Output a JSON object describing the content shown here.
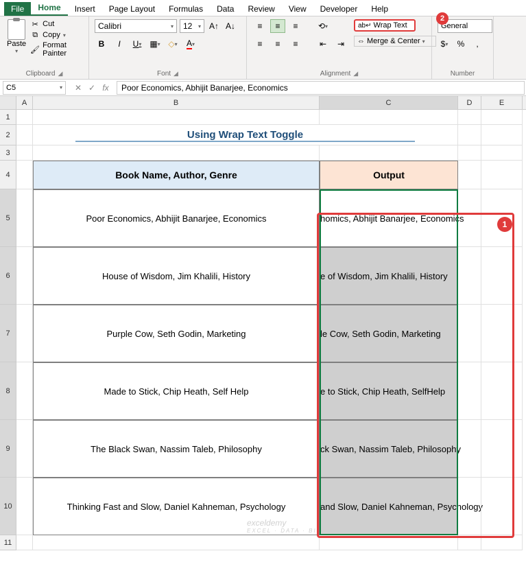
{
  "tabs": {
    "file": "File",
    "home": "Home",
    "insert": "Insert",
    "pagelayout": "Page Layout",
    "formulas": "Formulas",
    "data": "Data",
    "review": "Review",
    "view": "View",
    "developer": "Developer",
    "help": "Help"
  },
  "clipboard": {
    "paste": "Paste",
    "cut": "Cut",
    "copy": "Copy",
    "fmt": "Format Painter",
    "label": "Clipboard"
  },
  "font": {
    "name": "Calibri",
    "size": "12",
    "label": "Font"
  },
  "alignment": {
    "wrap": "Wrap Text",
    "merge": "Merge & Center",
    "label": "Alignment"
  },
  "number": {
    "format": "General",
    "label": "Number"
  },
  "namebox": "C5",
  "formula": "Poor Economics, Abhijit Banarjee, Economics",
  "title": "Using Wrap Text Toggle",
  "headers": {
    "b": "Book Name, Author, Genre",
    "c": "Output"
  },
  "rows": [
    {
      "b": "Poor Economics, Abhijit Banarjee, Economics",
      "c_vis": "homics, Abhijit Banarjee, E",
      "c_over": "conomics"
    },
    {
      "b": "House of Wisdom, Jim Khalili, History",
      "c_vis": "e of Wisdom, Jim Khalili, H",
      "c_over": "istory"
    },
    {
      "b": "Purple Cow, Seth Godin, Marketing",
      "c_vis": "le Cow, Seth Godin, Mark",
      "c_over": "eting"
    },
    {
      "b": "Made to Stick, Chip Heath, Self Help",
      "c_vis": "e to Stick, Chip Heath, Self",
      "c_over": " Help"
    },
    {
      "b": "The Black Swan, Nassim Taleb, Philosophy",
      "c_vis": "ck Swan, Nassim Taleb, Ph",
      "c_over": "ilosophy"
    },
    {
      "b": "Thinking Fast and Slow, Daniel Kahneman, Psychology",
      "c_vis": "and Slow, Daniel Kahnema",
      "c_over": "n, Psychology"
    }
  ],
  "badges": {
    "one": "1",
    "two": "2"
  },
  "cols": [
    "A",
    "B",
    "C",
    "D",
    "E"
  ],
  "rownums": [
    "1",
    "2",
    "3",
    "4",
    "5",
    "6",
    "7",
    "8",
    "9",
    "10",
    "11"
  ],
  "watermark": {
    "main": "exceldemy",
    "sub": "EXCEL · DATA · BI"
  }
}
